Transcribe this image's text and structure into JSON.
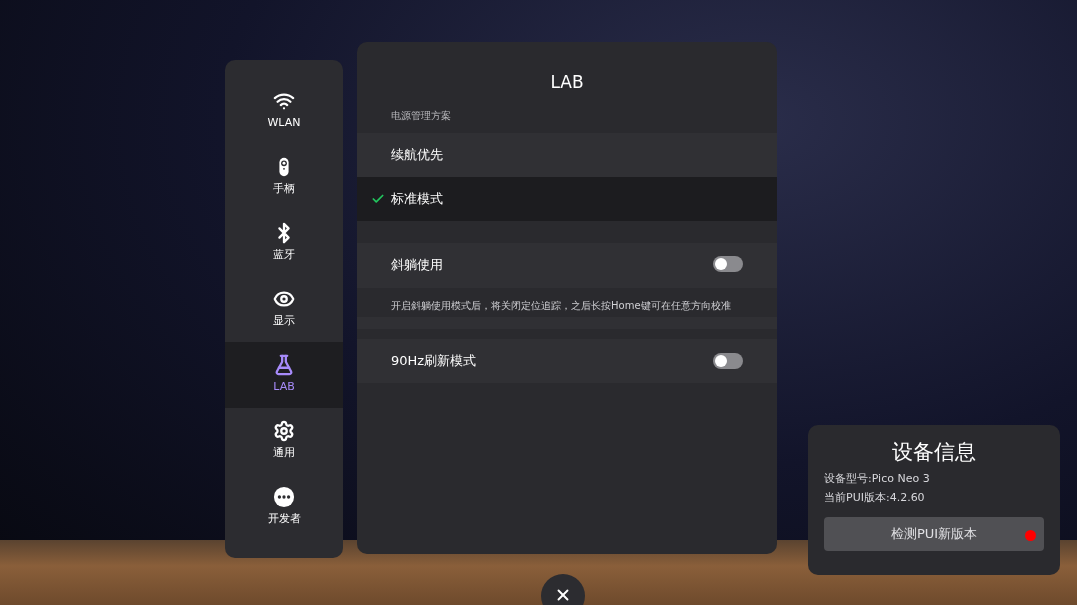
{
  "sidebar": {
    "items": [
      {
        "label": "WLAN",
        "selected": false
      },
      {
        "label": "手柄",
        "selected": false
      },
      {
        "label": "蓝牙",
        "selected": false
      },
      {
        "label": "显示",
        "selected": false
      },
      {
        "label": "LAB",
        "selected": true
      },
      {
        "label": "通用",
        "selected": false
      },
      {
        "label": "开发者",
        "selected": false
      }
    ]
  },
  "panel": {
    "title": "LAB",
    "power": {
      "label": "电源管理方案",
      "options": [
        {
          "label": "续航优先",
          "selected": false
        },
        {
          "label": "标准模式",
          "selected": true
        }
      ]
    },
    "toggles": [
      {
        "label": "斜躺使用",
        "on": false,
        "description": "开启斜躺使用模式后，将关闭定位追踪，之后长按Home键可在任意方向校准"
      },
      {
        "label": "90Hz刷新模式",
        "on": false
      }
    ]
  },
  "device_info": {
    "title": "设备信息",
    "lines": [
      "设备型号:Pico Neo 3",
      "当前PUI版本:4.2.60"
    ],
    "button": "检测PUI新版本",
    "update_dot": true
  }
}
